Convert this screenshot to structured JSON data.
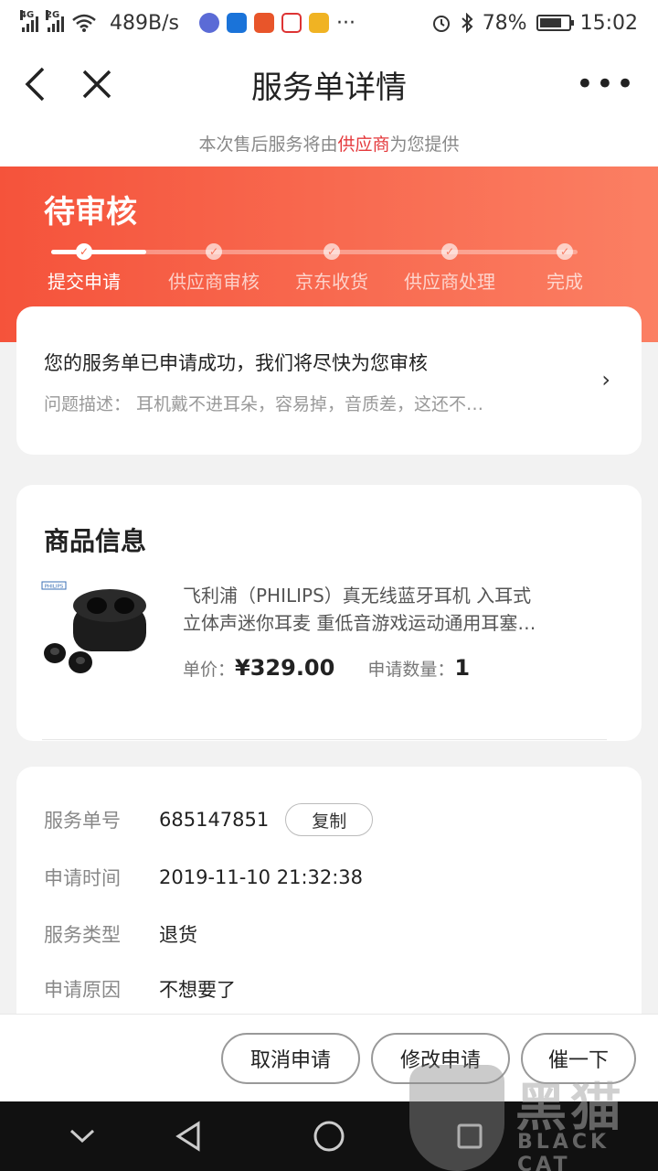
{
  "status_bar": {
    "net1": "4G",
    "net2": "2G",
    "speed": "489B/s",
    "apps": [
      "music-app-icon",
      "shield-app-icon",
      "game-app-icon",
      "maps-app-icon",
      "photo-app-icon"
    ],
    "more": "···",
    "battery_text": "78%",
    "battery_level": 0.78,
    "time": "15:02"
  },
  "nav": {
    "title": "服务单详情",
    "more": "•••"
  },
  "notice": {
    "prefix": "本次售后服务将由",
    "highlight": "供应商",
    "suffix": "为您提供"
  },
  "status": {
    "title": "待审核",
    "progress_fraction": 0.18,
    "steps": [
      {
        "label": "提交申请",
        "active": true
      },
      {
        "label": "供应商审核",
        "active": false
      },
      {
        "label": "京东收货",
        "active": false
      },
      {
        "label": "供应商处理",
        "active": false
      },
      {
        "label": "完成",
        "active": false
      }
    ]
  },
  "message": {
    "main": "您的服务单已申请成功，我们将尽快为您审核",
    "sub": "问题描述：  耳机戴不进耳朵，容易掉，音质差，这还不…",
    "arrow": "›"
  },
  "product": {
    "heading": "商品信息",
    "brand_mark": "PHILIPS",
    "name_line1": "飞利浦（PHILIPS）真无线蓝牙耳机 入耳式",
    "name_line2": "立体声迷你耳麦 重低音游戏运动通用耳塞…",
    "price_label": "单价：",
    "price": "¥329.00",
    "qty_label": "申请数量：",
    "qty": "1"
  },
  "info": {
    "rows": [
      {
        "key": "服务单号",
        "value": "685147851"
      },
      {
        "key": "申请时间",
        "value": "2019-11-10 21:32:38"
      },
      {
        "key": "服务类型",
        "value": "退货"
      },
      {
        "key": "申请原因",
        "value": "不想要了"
      }
    ],
    "copy_label": "复制"
  },
  "actions": {
    "cancel": "取消申请",
    "modify": "修改申请",
    "urge": "催一下"
  },
  "watermark": {
    "text": "黑猫",
    "sub": "BLACK CAT"
  },
  "colors": {
    "accent": "#e4393c",
    "header_start": "#f5533b",
    "header_end": "#fb7f63"
  }
}
